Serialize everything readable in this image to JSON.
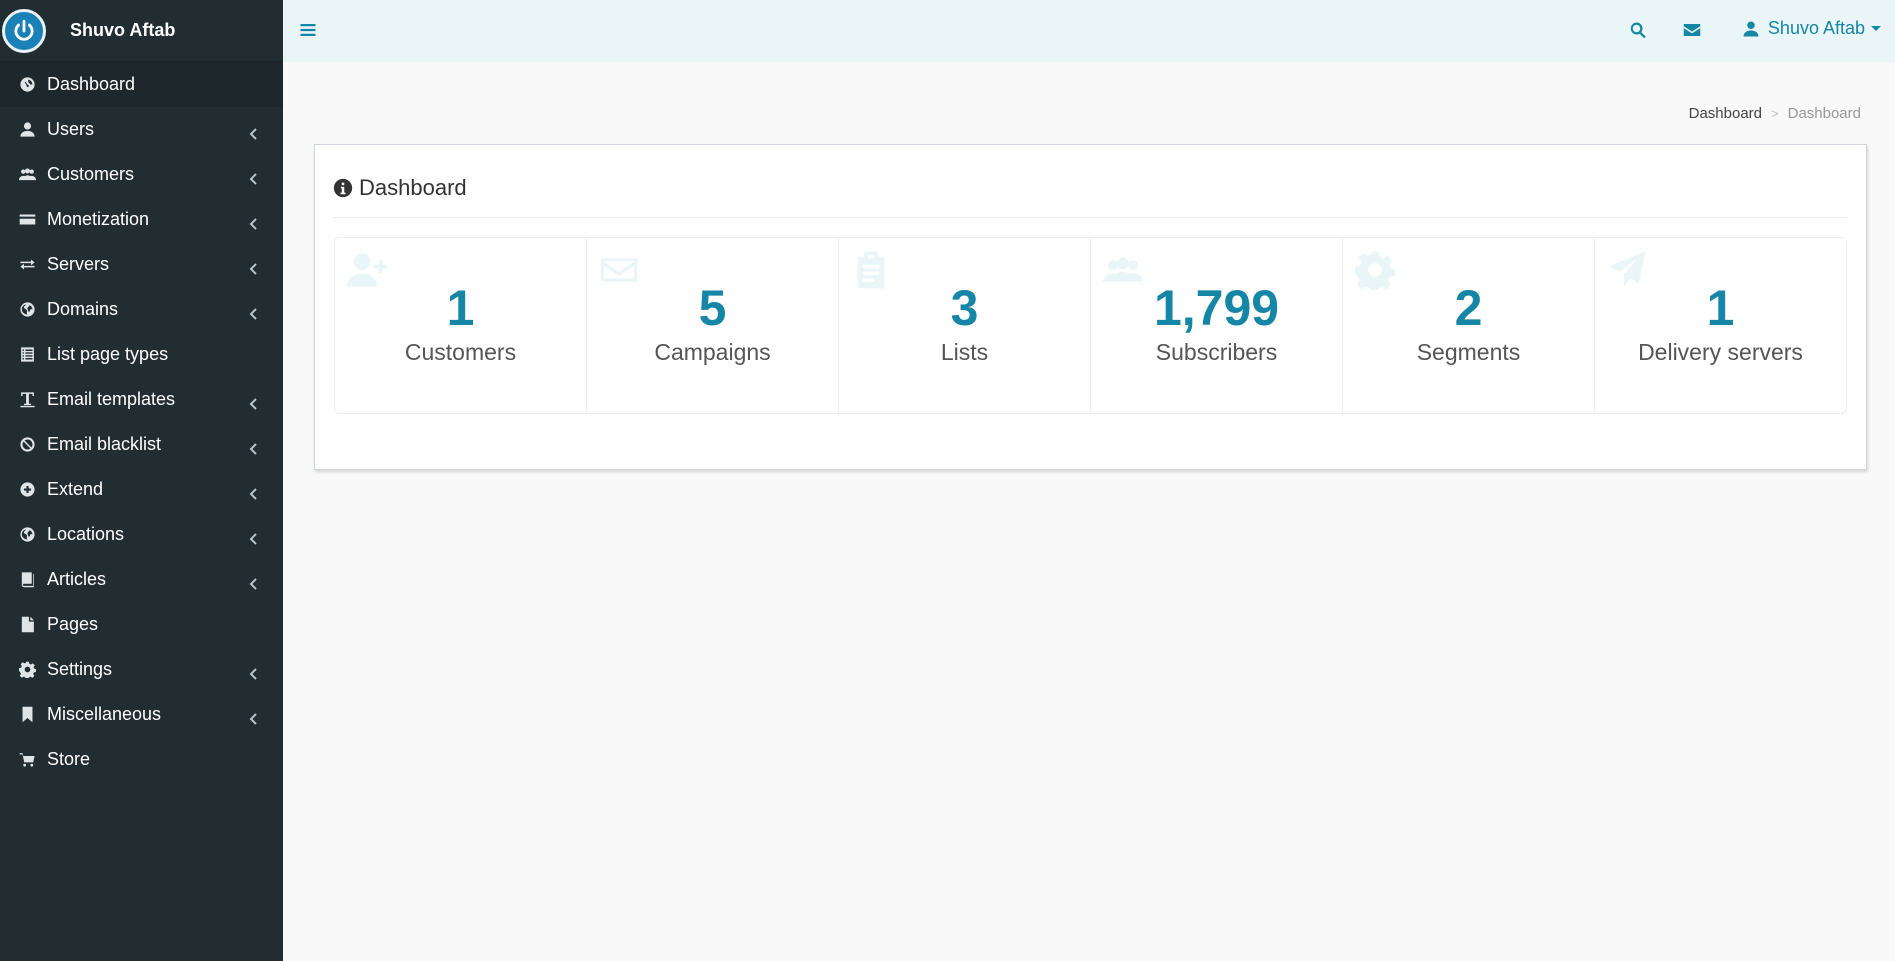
{
  "brand": {
    "name": "Shuvo Aftab"
  },
  "sidebar": {
    "items": [
      {
        "label": "Dashboard",
        "icon": "dashboard-icon",
        "expandable": false,
        "active": true
      },
      {
        "label": "Users",
        "icon": "user-icon",
        "expandable": true
      },
      {
        "label": "Customers",
        "icon": "users-icon",
        "expandable": true
      },
      {
        "label": "Monetization",
        "icon": "credit-card-icon",
        "expandable": true
      },
      {
        "label": "Servers",
        "icon": "exchange-icon",
        "expandable": true
      },
      {
        "label": "Domains",
        "icon": "globe-icon",
        "expandable": true
      },
      {
        "label": "List page types",
        "icon": "list-icon",
        "expandable": false
      },
      {
        "label": "Email templates",
        "icon": "text-icon",
        "expandable": true
      },
      {
        "label": "Email blacklist",
        "icon": "ban-icon",
        "expandable": true
      },
      {
        "label": "Extend",
        "icon": "plus-circle-icon",
        "expandable": true
      },
      {
        "label": "Locations",
        "icon": "globe-icon",
        "expandable": true
      },
      {
        "label": "Articles",
        "icon": "book-icon",
        "expandable": true
      },
      {
        "label": "Pages",
        "icon": "file-icon",
        "expandable": false
      },
      {
        "label": "Settings",
        "icon": "gear-icon",
        "expandable": true
      },
      {
        "label": "Miscellaneous",
        "icon": "bookmark-icon",
        "expandable": true
      },
      {
        "label": "Store",
        "icon": "cart-icon",
        "expandable": false
      }
    ]
  },
  "header": {
    "user_name": "Shuvo Aftab"
  },
  "breadcrumb": {
    "items": [
      "Dashboard",
      "Dashboard"
    ],
    "separator": ">"
  },
  "box": {
    "title": "Dashboard"
  },
  "stats": [
    {
      "value": "1",
      "label": "Customers",
      "icon": "user-plus-icon"
    },
    {
      "value": "5",
      "label": "Campaigns",
      "icon": "envelope-icon"
    },
    {
      "value": "3",
      "label": "Lists",
      "icon": "clipboard-icon"
    },
    {
      "value": "1,799",
      "label": "Subscribers",
      "icon": "users-icon"
    },
    {
      "value": "2",
      "label": "Segments",
      "icon": "gear-icon"
    },
    {
      "value": "1",
      "label": "Delivery servers",
      "icon": "paper-plane-icon"
    }
  ],
  "colors": {
    "accent": "#1586a5",
    "sidebar_bg": "#222d32",
    "header_bg": "#eaf5f7",
    "page_bg": "#f9f9f9"
  }
}
